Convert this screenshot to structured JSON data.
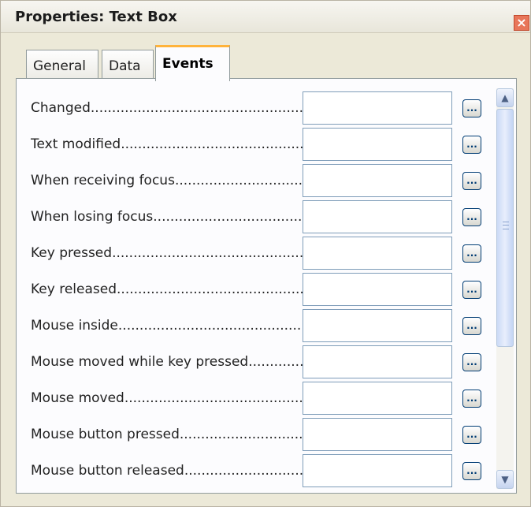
{
  "window": {
    "title": "Properties: Text Box",
    "close_glyph": "×"
  },
  "tabs": [
    {
      "label": "General"
    },
    {
      "label": "Data"
    },
    {
      "label": "Events",
      "active": true
    }
  ],
  "events": [
    {
      "label": "Changed",
      "value": ""
    },
    {
      "label": "Text modified",
      "value": ""
    },
    {
      "label": "When receiving focus",
      "value": ""
    },
    {
      "label": "When losing focus",
      "value": ""
    },
    {
      "label": "Key pressed",
      "value": ""
    },
    {
      "label": "Key released",
      "value": ""
    },
    {
      "label": "Mouse inside",
      "value": ""
    },
    {
      "label": "Mouse moved while key pressed",
      "value": ""
    },
    {
      "label": "Mouse moved",
      "value": ""
    },
    {
      "label": "Mouse button pressed",
      "value": ""
    },
    {
      "label": "Mouse button released",
      "value": ""
    }
  ],
  "dots": "..................................................",
  "assign_button_label": "...",
  "scrollbar": {
    "up_glyph": "▲",
    "down_glyph": "▼",
    "icon_up": "chevron-up-icon",
    "icon_down": "chevron-down-icon"
  },
  "colors": {
    "accent_tab": "#ffb33b",
    "close": "#e8765a",
    "field_border": "#7f9db9"
  }
}
